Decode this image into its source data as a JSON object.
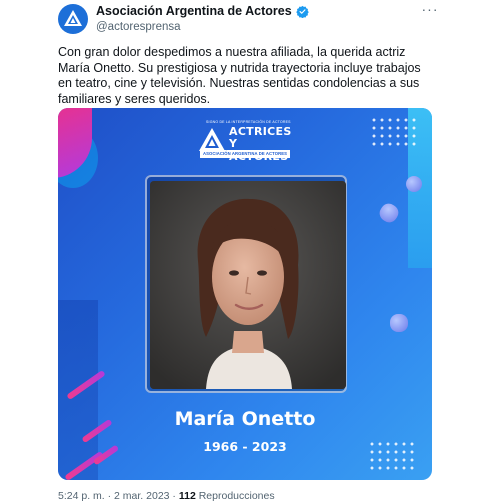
{
  "author": {
    "name": "Asociación Argentina de Actores",
    "handle": "@actoresprensa",
    "avatar_icon": "aaa-logo-icon",
    "verified_icon": "verified-badge-icon",
    "verified_color": "#1d9bf0"
  },
  "more_label": "···",
  "tweet": {
    "text": "Con gran dolor despedimos a nuestra afiliada, la querida actriz María Onetto. Su prestigiosa y nutrida trayectoria incluye trabajos en teatro, cine y televisión. Nuestras sentidas condolencias a sus familiares y seres queridos."
  },
  "media": {
    "logo": {
      "small_text": "SIGNO DE LA INTERPRETACIÓN DE ACTORES",
      "line1": "ACTRICES",
      "line2": "Y ACTORES",
      "band": "ASOCIACIÓN ARGENTINA DE ACTORES"
    },
    "name": "María Onetto",
    "years": "1966 - 2023",
    "colors": {
      "background_start": "#1f4fc7",
      "background_end": "#3aa0f2",
      "accent_pink": "#e9318d",
      "accent_purple": "#b03be0"
    }
  },
  "meta": {
    "time": "5:24 p. m.",
    "separator": "·",
    "date": "2 mar. 2023",
    "views_count": "112",
    "views_label": "Reproducciones"
  }
}
